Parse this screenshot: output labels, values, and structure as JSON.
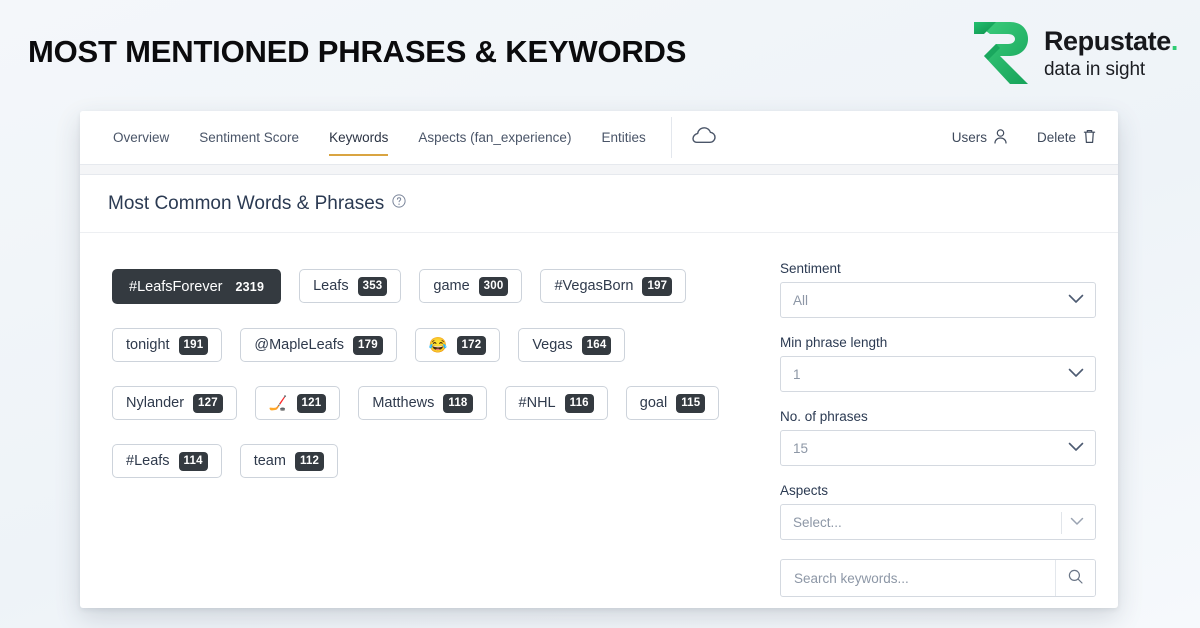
{
  "header": {
    "title": "MOST MENTIONED PHRASES & KEYWORDS",
    "logo": {
      "name": "Repustate",
      "name_dot": ".",
      "tagline": "data in sight",
      "mark_color": "#2ecb72"
    }
  },
  "tabbar": {
    "tabs": [
      {
        "label": "Overview",
        "active": false
      },
      {
        "label": "Sentiment Score",
        "active": false
      },
      {
        "label": "Keywords",
        "active": true
      },
      {
        "label": "Aspects (fan_experience)",
        "active": false
      },
      {
        "label": "Entities",
        "active": false
      }
    ],
    "cloud_icon": "cloud-icon",
    "active_underline_color": "#d9a441",
    "actions": [
      {
        "label": "Users",
        "icon": "user-icon"
      },
      {
        "label": "Delete",
        "icon": "trash-icon"
      }
    ]
  },
  "panel": {
    "title": "Most Common Words & Phrases",
    "help_icon": "question-circle-icon"
  },
  "keywords": {
    "selected_color": "#343a40",
    "rows": [
      [
        {
          "label": "#LeafsForever",
          "count": "2319",
          "selected": true
        },
        {
          "label": "Leafs",
          "count": "353",
          "selected": false
        },
        {
          "label": "game",
          "count": "300",
          "selected": false
        },
        {
          "label": "#VegasBorn",
          "count": "197",
          "selected": false
        }
      ],
      [
        {
          "label": "tonight",
          "count": "191",
          "selected": false
        },
        {
          "label": "@MapleLeafs",
          "count": "179",
          "selected": false
        },
        {
          "label": "😂",
          "count": "172",
          "selected": false,
          "is_emoji": true
        },
        {
          "label": "Vegas",
          "count": "164",
          "selected": false
        }
      ],
      [
        {
          "label": "Nylander",
          "count": "127",
          "selected": false
        },
        {
          "label": "🏒",
          "count": "121",
          "selected": false,
          "is_emoji": true
        },
        {
          "label": "Matthews",
          "count": "118",
          "selected": false
        },
        {
          "label": "#NHL",
          "count": "116",
          "selected": false
        },
        {
          "label": "goal",
          "count": "115",
          "selected": false
        }
      ],
      [
        {
          "label": "#Leafs",
          "count": "114",
          "selected": false
        },
        {
          "label": "team",
          "count": "112",
          "selected": false
        }
      ]
    ]
  },
  "filters": {
    "sentiment": {
      "label": "Sentiment",
      "value": "All"
    },
    "min_phrase_length": {
      "label": "Min phrase length",
      "value": "1"
    },
    "no_of_phrases": {
      "label": "No. of phrases",
      "value": "15"
    },
    "aspects": {
      "label": "Aspects",
      "value": "Select..."
    },
    "search": {
      "placeholder": "Search keywords...",
      "value": "",
      "icon": "search-icon"
    }
  }
}
